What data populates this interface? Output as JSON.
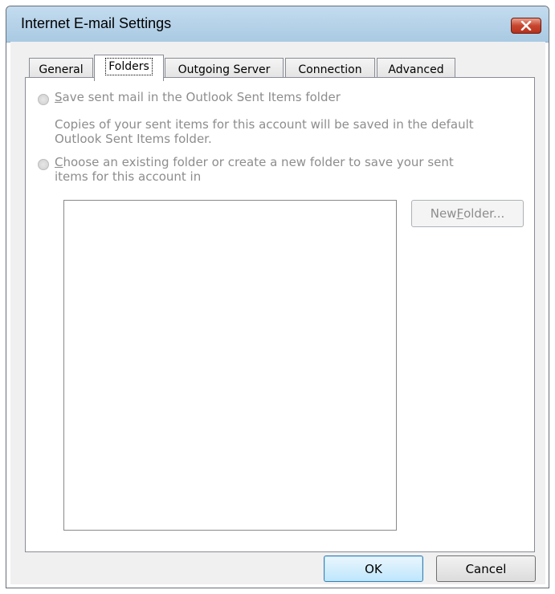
{
  "window": {
    "title": "Internet E-mail Settings"
  },
  "tabs": [
    {
      "label": "General",
      "active": false
    },
    {
      "label": "Folders",
      "active": true
    },
    {
      "label": "Outgoing Server",
      "active": false
    },
    {
      "label": "Connection",
      "active": false
    },
    {
      "label": "Advanced",
      "active": false
    }
  ],
  "folders": {
    "option1": {
      "prefix": "",
      "accel": "S",
      "rest": "ave sent mail in the Outlook Sent Items folder",
      "enabled": false
    },
    "option1_description_line1": "Copies of your sent items for this account will be saved in the default",
    "option1_description_line2": "Outlook Sent Items folder.",
    "option2": {
      "accel": "C",
      "rest": "hoose an existing folder or create a new folder to save your sent",
      "line2": "items for this account in",
      "enabled": false
    },
    "new_folder": {
      "prefix": "New ",
      "accel": "F",
      "rest": "older...",
      "enabled": false
    }
  },
  "buttons": {
    "ok": "OK",
    "cancel": "Cancel"
  },
  "colors": {
    "titlebar": "#b9d3e9",
    "client": "#f0f0f0",
    "disabled_text": "#8d8d8d",
    "close_button": "#c7452e"
  }
}
